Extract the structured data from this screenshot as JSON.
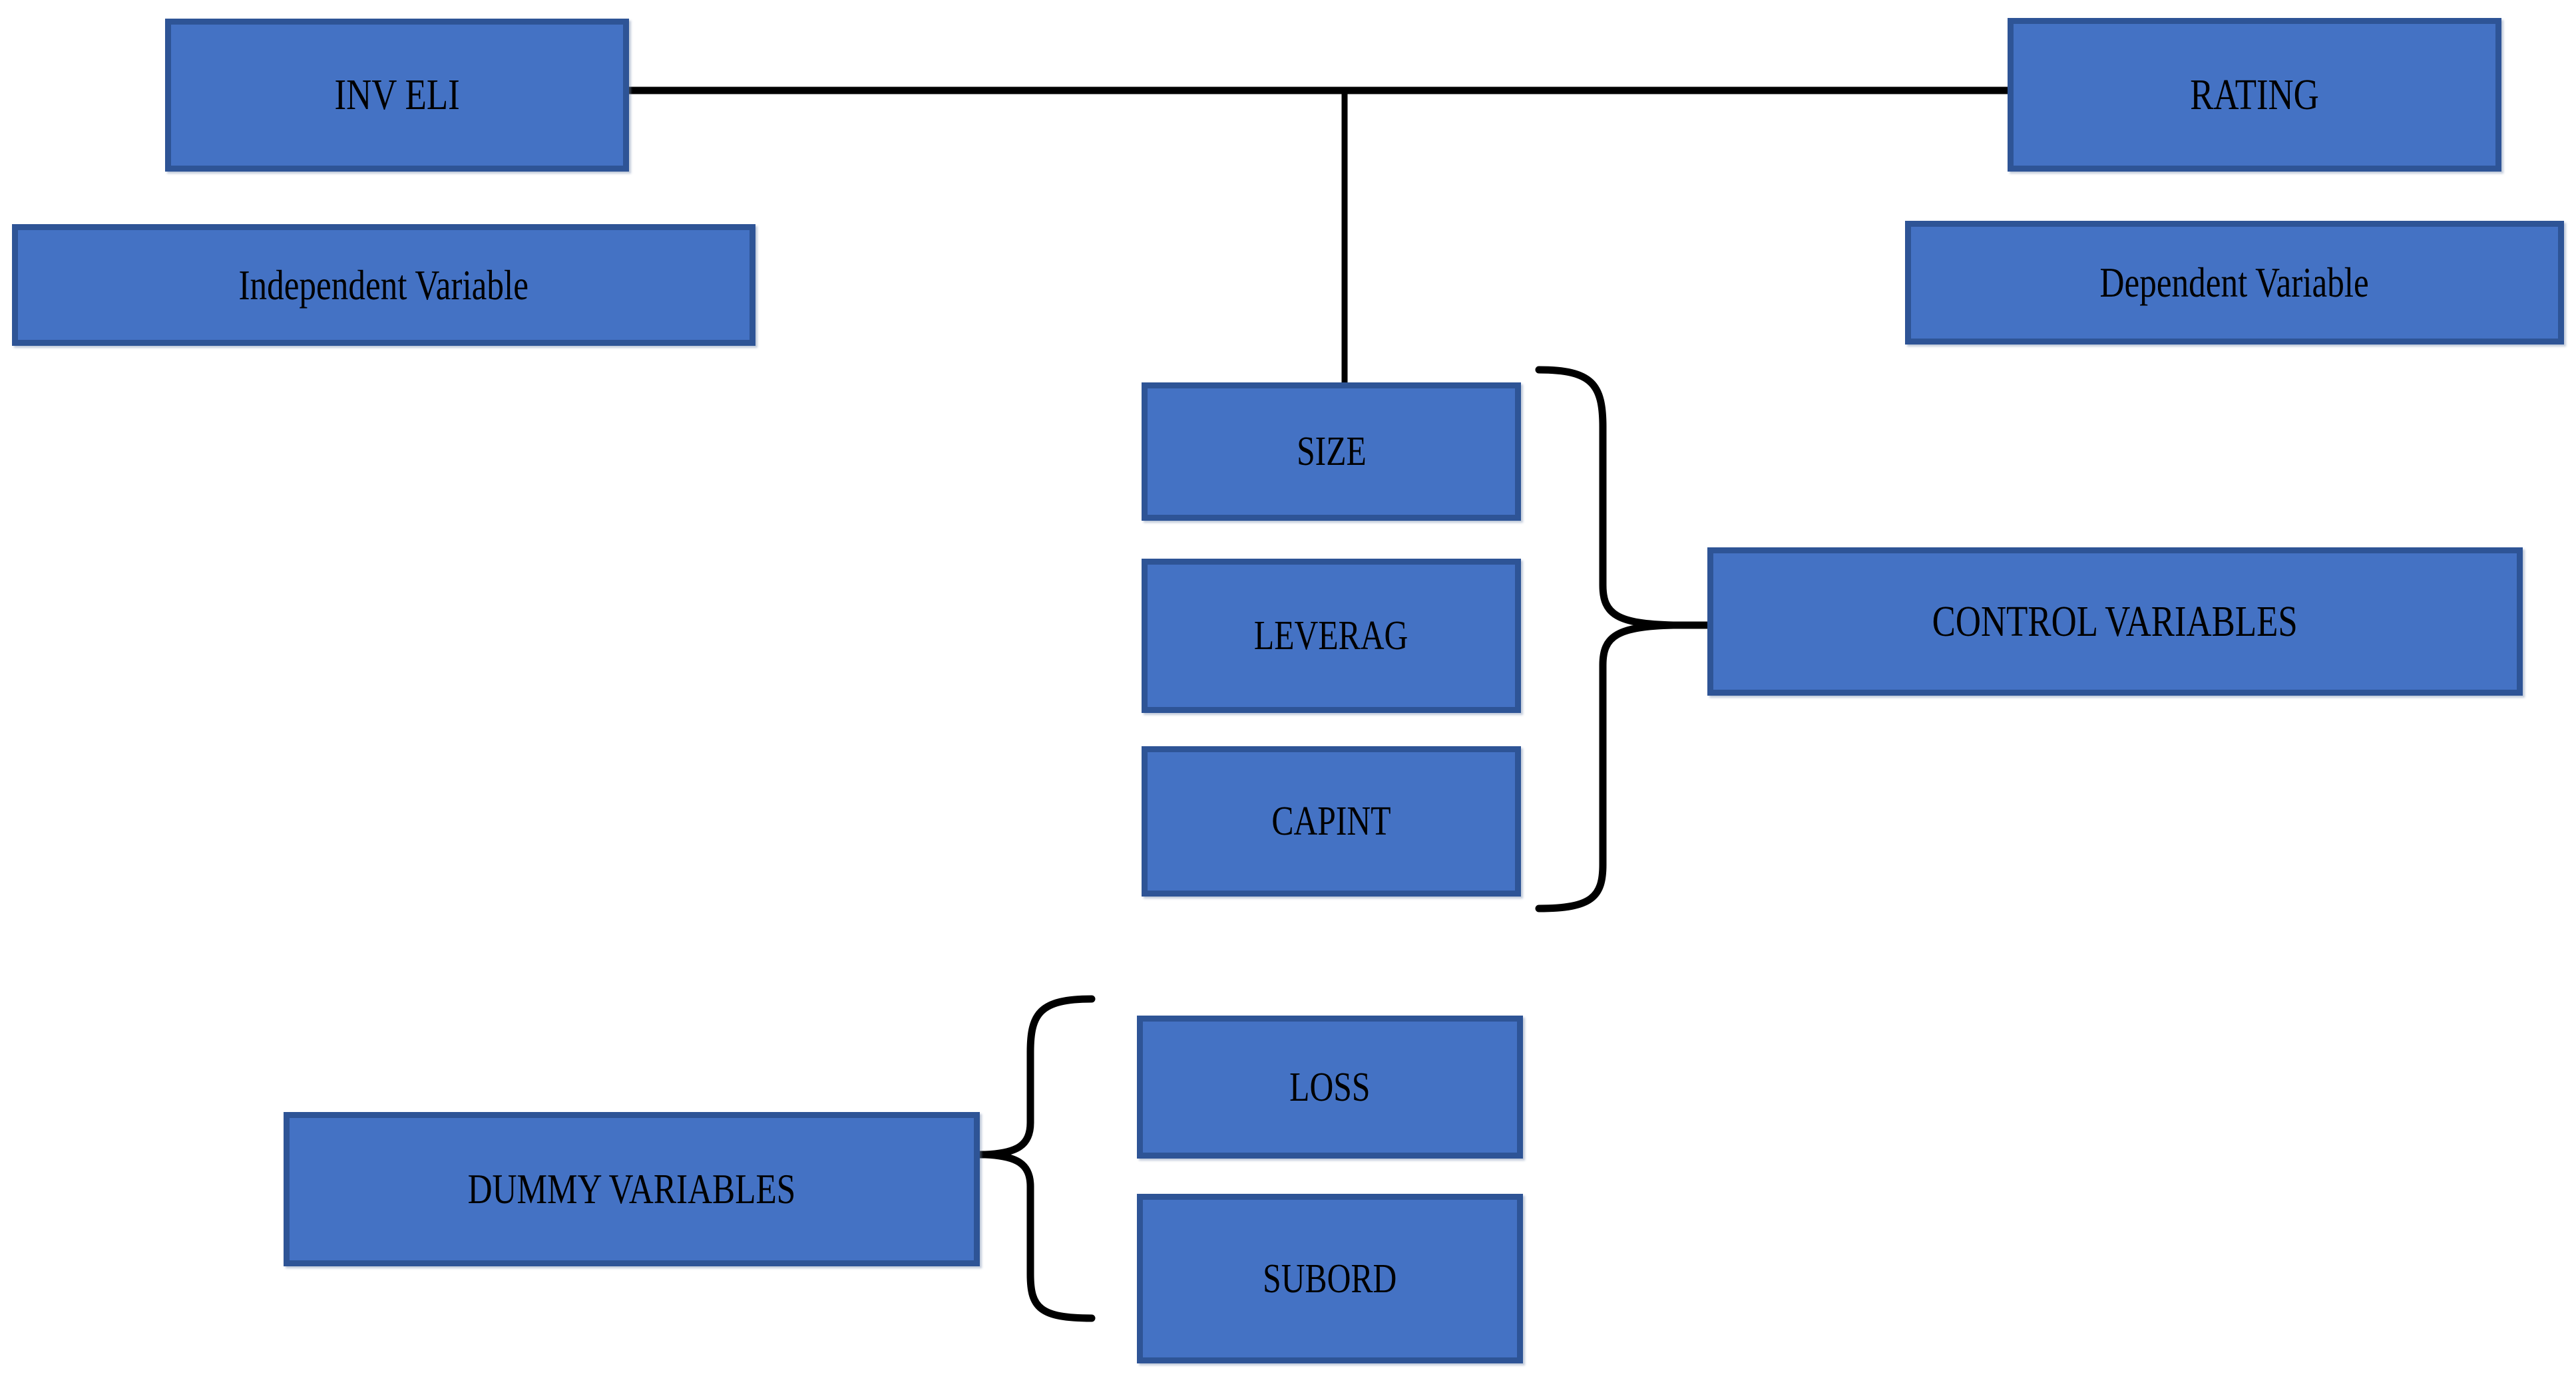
{
  "diagram": {
    "title": "Research variables framework",
    "colors": {
      "box_fill": "#4472C4",
      "box_border": "#2E5496",
      "connector": "#000000",
      "background": "#FFFFFF",
      "text": "#000000"
    },
    "nodes": {
      "inveli": {
        "label": "INV ELI"
      },
      "rating": {
        "label": "RATING"
      },
      "independent_variable": {
        "label": "Independent Variable"
      },
      "dependent_variable": {
        "label": "Dependent Variable"
      },
      "size": {
        "label": "SIZE"
      },
      "leverag": {
        "label": "LEVERAG"
      },
      "capint": {
        "label": "CAPINT"
      },
      "control_variables": {
        "label": "CONTROL VARIABLES"
      },
      "dummy_variables": {
        "label": "DUMMY VARIABLES"
      },
      "loss": {
        "label": "LOSS"
      },
      "subord": {
        "label": "SUBORD"
      }
    },
    "connectors": [
      {
        "name": "inveli-to-rating",
        "type": "horizontal-line"
      },
      {
        "name": "inveli-rating-to-size",
        "type": "vertical-drop"
      },
      {
        "name": "control-variables-brace",
        "type": "right-facing-brace"
      },
      {
        "name": "dummy-variables-brace",
        "type": "left-facing-brace"
      }
    ]
  }
}
